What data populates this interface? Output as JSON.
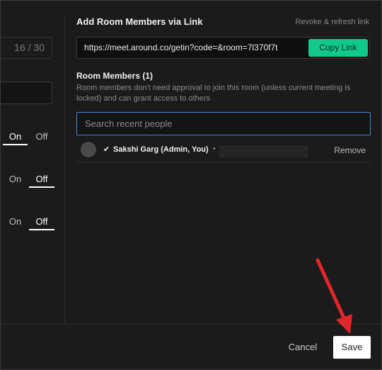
{
  "left_panel": {
    "counter": "16 / 30",
    "toggles": [
      {
        "on_label": "On",
        "off_label": "Off",
        "selected": "on"
      },
      {
        "on_label": "On",
        "off_label": "Off",
        "selected": "off"
      },
      {
        "on_label": "On",
        "off_label": "Off",
        "selected": "off"
      }
    ]
  },
  "invite_link": {
    "title": "Add Room Members via Link",
    "revoke_label": "Revoke & refresh link",
    "url": "https://meet.around.co/getin?code=&room=7l370f7t",
    "copy_label": "Copy Link"
  },
  "members": {
    "title": "Room Members (1)",
    "description": "Room members don't need approval to join this room (unless current meeting is locked) and can grant access to others",
    "search_placeholder": "Search recent people",
    "list": [
      {
        "check": "✔",
        "name": "Sakshi Garg (Admin, You)",
        "separator": "•",
        "remove_label": "Remove"
      }
    ]
  },
  "footer": {
    "cancel_label": "Cancel",
    "save_label": "Save"
  },
  "colors": {
    "accent": "#11c98a",
    "focus_border": "#4a86d8",
    "annotation_arrow": "#e3262b"
  }
}
